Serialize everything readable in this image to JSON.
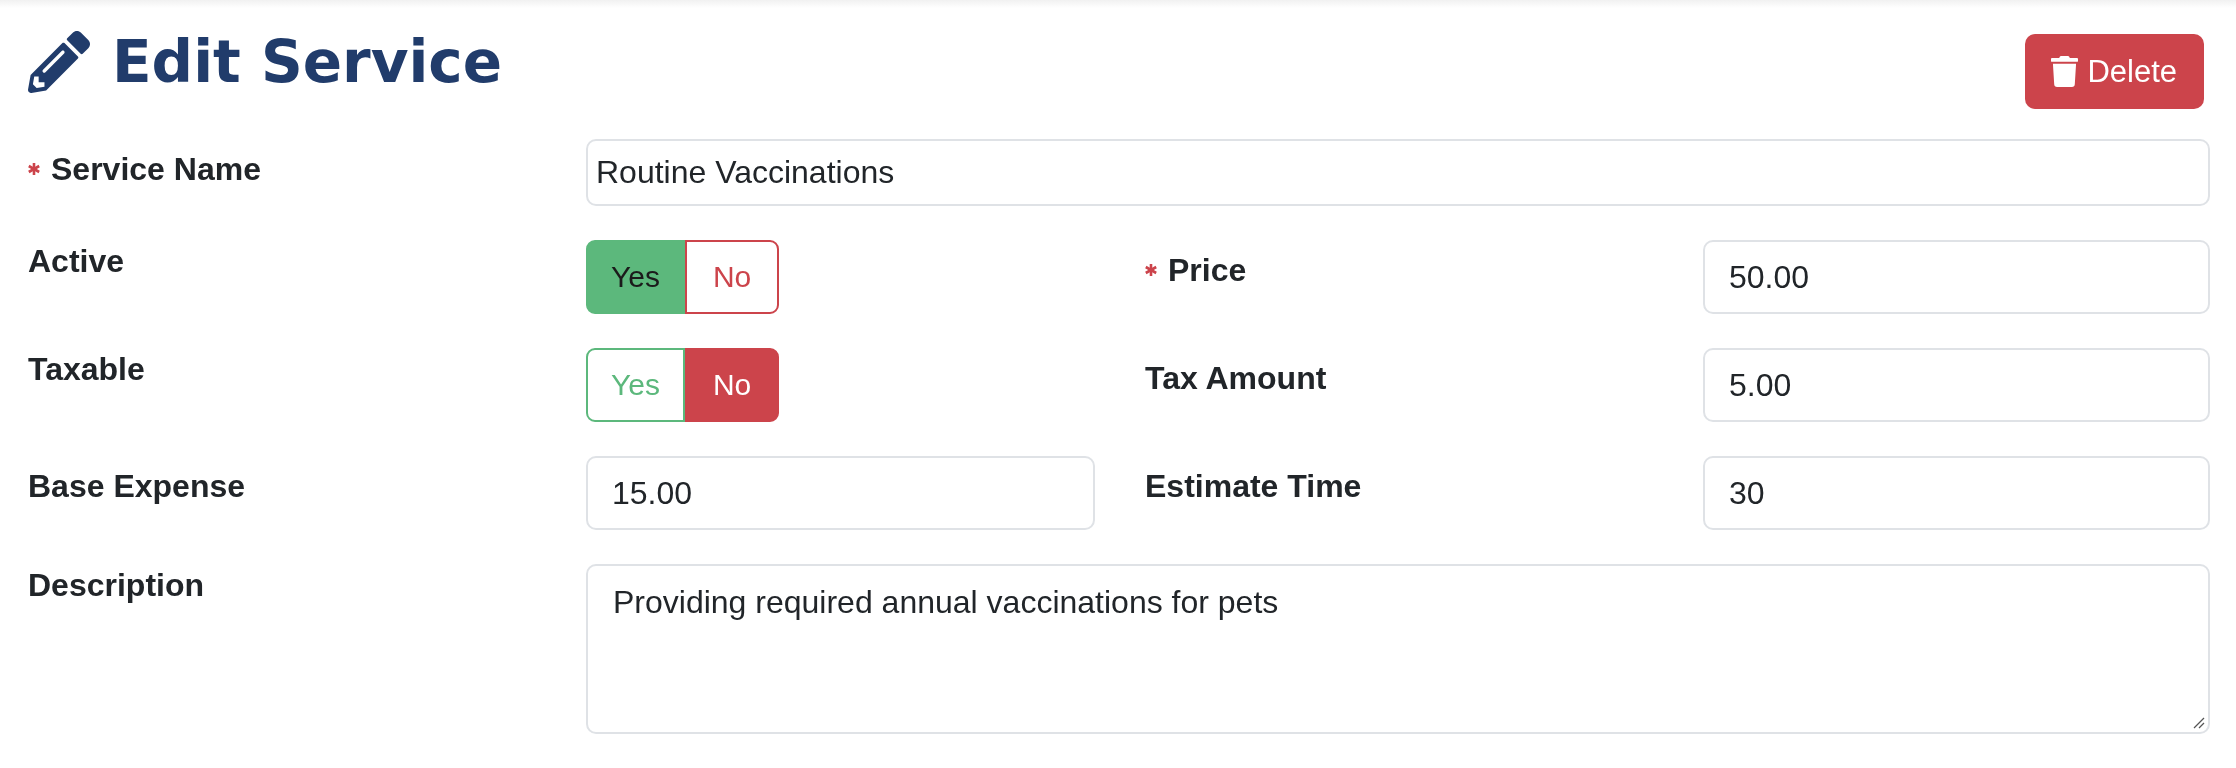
{
  "header": {
    "title": "Edit Service",
    "delete_button": {
      "label": "Delete"
    }
  },
  "form": {
    "rows": [
      {
        "fields": [
          {
            "kind": "text",
            "label": "Service Name",
            "required": true,
            "value": "Routine Vaccinations"
          }
        ]
      },
      {
        "fields": [
          {
            "kind": "toggle",
            "label": "Active",
            "required": false,
            "options": [
              {
                "label": "Yes",
                "selected": true,
                "color": "#5cb87c"
              },
              {
                "label": "No",
                "selected": false,
                "color": "#cc444b"
              }
            ]
          },
          {
            "kind": "text",
            "label": "Price",
            "required": true,
            "value": "50.00"
          }
        ]
      },
      {
        "fields": [
          {
            "kind": "toggle",
            "label": "Taxable",
            "required": false,
            "options": [
              {
                "label": "Yes",
                "selected": false,
                "color": "#5cb87c"
              },
              {
                "label": "No",
                "selected": true,
                "color": "#cc444b"
              }
            ]
          },
          {
            "kind": "text",
            "label": "Tax Amount",
            "required": false,
            "value": "5.00"
          }
        ]
      },
      {
        "fields": [
          {
            "kind": "text",
            "label": "Base Expense",
            "required": false,
            "value": "15.00"
          },
          {
            "kind": "text",
            "label": "Estimate Time",
            "required": false,
            "value": "30"
          }
        ]
      },
      {
        "fields": [
          {
            "kind": "textarea",
            "label": "Description",
            "required": false,
            "value": "Providing required annual vaccinations for pets"
          }
        ]
      }
    ]
  }
}
